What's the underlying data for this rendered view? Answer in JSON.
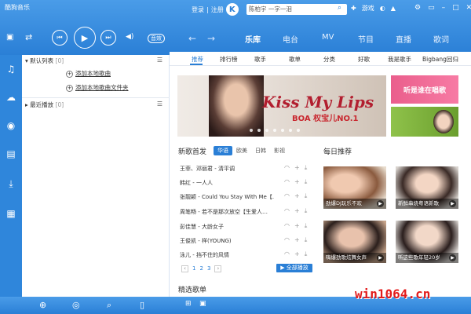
{
  "app": {
    "title": "酷狗音乐"
  },
  "topbar": {
    "login": "登录",
    "sep": "|",
    "register": "注册",
    "logo_letter": "K",
    "search_placeholder": "陈柏宇 一字一泪",
    "game_label": "游戏"
  },
  "nav": {
    "tabs": [
      "乐库",
      "电台",
      "MV",
      "节目",
      "直播",
      "歌词"
    ],
    "active": "乐库"
  },
  "player": {
    "sound_effect": "音效"
  },
  "sidebar": {
    "sections": [
      {
        "label": "默认列表",
        "count": "[0]"
      },
      {
        "label": "最近播放",
        "count": "[0]"
      }
    ],
    "add_song": "添加本地歌曲",
    "add_folder": "添加本地歌曲文件夹"
  },
  "subtabs": [
    "推荐",
    "排行榜",
    "歌手",
    "歌单",
    "分类",
    "好歌",
    "我是歌手",
    "Bigbang回归"
  ],
  "banner": {
    "title": "Kiss My Lips",
    "subtitle": "BOA 权宝儿NO.1"
  },
  "side_ad": {
    "text": "听是谁在唱歌"
  },
  "new_songs": {
    "title": "新歌首发",
    "tabs": [
      "华语",
      "欧美",
      "日韩",
      "影视"
    ],
    "active_tab": "华语",
    "songs": [
      "王菲、邓丽君 - 清平调",
      "韩红 - 一人人",
      "张靓颖 - Could You Stay With Me【…",
      "周笔畅 - 若不是那次放空【生爱人…",
      "彭佳慧 - 大龄女子",
      "王俊凯 - 样(YOUNG)",
      "泳儿 - 挡不住的风情"
    ],
    "pages": [
      "1",
      "2",
      "3"
    ],
    "play_all": "全部播放"
  },
  "daily": {
    "title": "每日推荐",
    "items": [
      "劲爆DJ玩乐不欢",
      "新鲜串烧粤语新歌",
      "嗨爆劲歌炫舞女声",
      "听这些歌年轻20岁"
    ]
  },
  "featured": {
    "title": "精选歌单"
  },
  "watermark": "win1064.cn",
  "colors": {
    "accent": "#2a7fd6",
    "brand_red": "#b21e2f"
  }
}
